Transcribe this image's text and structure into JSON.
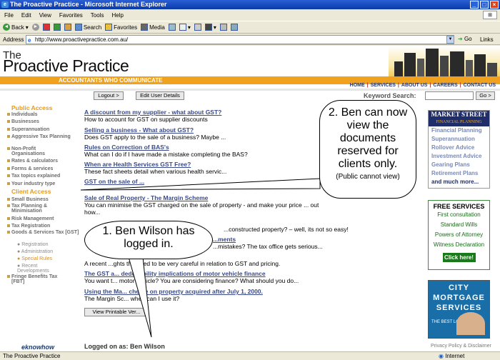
{
  "window": {
    "title": "The Proactive Practice - Microsoft Internet Explorer",
    "min": "_",
    "max": "□",
    "close": "×"
  },
  "menu": [
    "File",
    "Edit",
    "View",
    "Favorites",
    "Tools",
    "Help"
  ],
  "toolbar": {
    "back": "Back",
    "forward": "",
    "search": "Search",
    "favorites": "Favorites",
    "media": "Media"
  },
  "address": {
    "label": "Address",
    "url": "http://www.proactivepractice.com.au/",
    "go": "Go",
    "links": "Links"
  },
  "site": {
    "logo_line1": "The",
    "logo_line2": "Proactive Practice",
    "tagline": "ACCOUNTANTS WHO COMMUNICATE",
    "nav": [
      "HOME",
      "SERVICES",
      "ABOUT US",
      "CAREERS",
      "CONTACT US"
    ],
    "logout": "Logout >",
    "edit_user": "Edit User Details",
    "keyword_label": "Keyword Search:",
    "keyword_go": "Go >"
  },
  "sidebar": {
    "public_head": "Public Access",
    "public_items": [
      "Individuals",
      "Businesses",
      "Superannuation",
      "Aggressive Tax Planning",
      "Non-Profit Organisations",
      "Rates & calculators",
      "Forms & services",
      "Tax topics explained",
      "Your industry type"
    ],
    "client_head": "Client Access",
    "client_items": [
      "Small Business",
      "Tax Planning & Minimisation",
      "Risk Management",
      "Tax Registration",
      "Goods & Services Tax [GST]"
    ],
    "gst_sub": [
      "Registration",
      "Administration",
      "Special Rules",
      "Recent Developments"
    ],
    "fbt": "Fringe Benefits Tax [FBT]",
    "eknowhow": "eknowhow"
  },
  "articles": [
    {
      "title": "A discount from my supplier - what about GST?",
      "desc": "How to account for GST on supplier discounts"
    },
    {
      "title": "Selling a business - What about GST?",
      "desc": "Does GST apply to the sale of a business? Maybe ..."
    },
    {
      "title": "Rules on Correction of BAS's",
      "desc": "What can I do if I have made a mistake completing the BAS?"
    },
    {
      "title": "When are Health Services GST Free?",
      "desc": "These fact sheets detail when various health servic..."
    },
    {
      "title": "GST on the sale of ...",
      "desc": ""
    },
    {
      "title": "Sale of Real Property - The Margin Scheme",
      "desc": "You can minimise the GST charged on the sale of property - and make your price ... out"
    },
    {
      "title": "",
      "desc": "how..."
    },
    {
      "title": "",
      "desc": "...constructed property? – well, its not so easy!"
    },
    {
      "title": "...ments",
      "desc": "...mistakes? The tax office gets serious..."
    },
    {
      "title": "",
      "desc": "A recent ...ghts the need to be very careful in relation to GST and pricing."
    },
    {
      "title": "The GST a... deductibility implications of motor vehicle finance",
      "desc": "You want t... motor vehicle? You are considering finance? What should you do..."
    },
    {
      "title": "Using the Ma... cheme on property acquired after July 1, 2000.",
      "desc": "The Margin Sc... when can I use it?"
    }
  ],
  "view_printable": "View Printable Ver...",
  "logged_in": "Logged on as: Ben Wilson",
  "privacy": "Privacy Policy & Disclaimer",
  "ads": {
    "market_street": {
      "title": "MARKET STREET",
      "sub": "FINANCIAL PLANNING",
      "items": [
        "Financial Planning",
        "Superannuation",
        "Rollover Advice",
        "Investment Advice",
        "Gearing Plans",
        "Retirement Plans",
        "and much more..."
      ]
    },
    "free_services": {
      "title": "FREE SERVICES",
      "items": [
        "First consultation",
        "Standard Wills",
        "Powers of Attorney",
        "Witness Declaration"
      ],
      "cta": "Click here!"
    },
    "city_mortgage": {
      "title": "CITY MORTGAGE SERVICES",
      "blurb": "THE BEST LOANS"
    }
  },
  "callouts": {
    "one": "1.  Ben Wilson has logged in.",
    "two": "2.  Ben can now view the documents reserved for clients only.",
    "two_small": "(Public cannot view)"
  },
  "status": {
    "left": "The Proactive Practice",
    "right": "Internet"
  }
}
